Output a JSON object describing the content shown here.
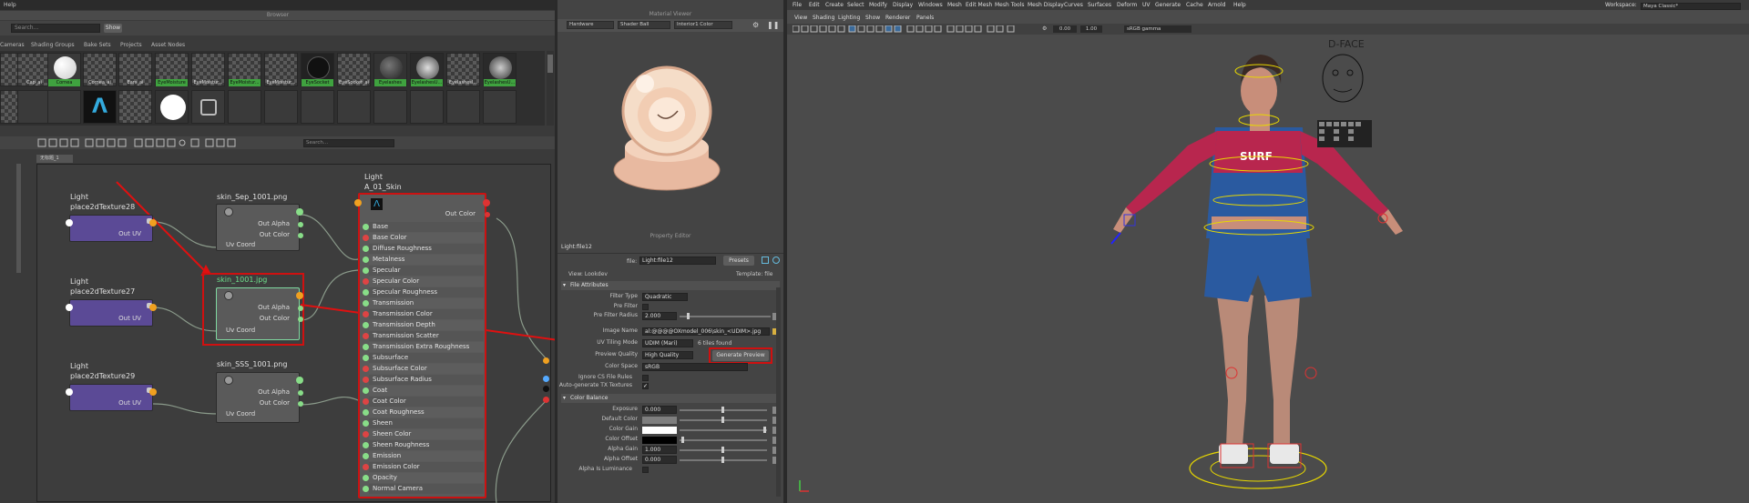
{
  "topbar": {
    "help_label": "Help"
  },
  "browser": {
    "title": "Browser",
    "search_placeholder": "Search...",
    "show_label": "Show",
    "tabs": [
      "Cameras",
      "Shading Groups",
      "Bake Sets",
      "Projects",
      "Asset Nodes"
    ],
    "thumbs_row1": [
      "",
      "Cap_ai",
      "Cornea",
      "Cornea_ai",
      "Ears_ai",
      "EyeMoisture",
      "EyeMoistur...",
      "EyeMoistur...",
      "EyeMoistur...",
      "EyeSocket",
      "EyeSocket_ai",
      "Eyelashes",
      "EyelashesU...",
      "EyelashesI...",
      "EyelashesU..."
    ],
    "green_labels": [
      "Cornea",
      "EyeMoisture",
      "EyeMoistur...",
      "EyeSocket",
      "Eyelashes",
      "EyelashesU...",
      "EyelashesU..."
    ]
  },
  "hypershade": {
    "tab_label": "无标题_1",
    "search_placeholder": "Search..."
  },
  "nodes": {
    "tex28": {
      "title1": "Light",
      "title2": "place2dTexture28",
      "out": "Out UV"
    },
    "tex27": {
      "title1": "Light",
      "title2": "place2dTexture27",
      "out": "Out UV"
    },
    "tex29": {
      "title1": "Light",
      "title2": "place2dTexture29",
      "out": "Out UV"
    },
    "sep": {
      "title": "skin_Sep_1001.png",
      "alpha": "Out Alpha",
      "color": "Out Color",
      "uv": "Uv Coord"
    },
    "skin": {
      "title": "skin_1001.jpg",
      "alpha": "Out Alpha",
      "color": "Out Color",
      "uv": "Uv Coord"
    },
    "sss": {
      "title": "skin_SSS_1001.png",
      "alpha": "Out Alpha",
      "color": "Out Color",
      "uv": "Uv Coord"
    },
    "shader": {
      "title1": "Light",
      "title2": "A_01_Skin",
      "out": "Out Color",
      "attrs": [
        "Base",
        "Base Color",
        "Diffuse Roughness",
        "Metalness",
        "Specular",
        "Specular Color",
        "Specular Roughness",
        "Transmission",
        "Transmission Color",
        "Transmission Depth",
        "Transmission Scatter",
        "Transmission Extra Roughness",
        "Subsurface",
        "Subsurface Color",
        "Subsurface Radius",
        "Coat",
        "Coat Color",
        "Coat Roughness",
        "Sheen",
        "Sheen Color",
        "Sheen Roughness",
        "Emission",
        "Emission Color",
        "Opacity",
        "Normal Camera"
      ]
    }
  },
  "material_viewer": {
    "title": "Material Viewer",
    "renderer": "Hardware",
    "shape": "Shader Ball",
    "env": "Interior1 Color"
  },
  "property_editor": {
    "title": "Property Editor",
    "node_name": "Light:file12",
    "file_label": "file:",
    "file_value": "Light:file12",
    "presets": "Presets",
    "view": "View: Lookdev",
    "template": "Template: file",
    "file_attrs": "File Attributes",
    "filter_type_lbl": "Filter Type",
    "filter_type": "Quadratic",
    "pre_filter_lbl": "Pre Filter",
    "pre_filter_radius_lbl": "Pre Filter Radius",
    "pre_filter_radius": "2.000",
    "image_name_lbl": "Image Name",
    "image_name": "al:@@@@OXmodel_006\\skin_<UDIM>.jpg",
    "tiling_lbl": "UV Tiling Mode",
    "tiling": "UDIM (Mari)",
    "tiles_found": "6 tiles found",
    "preview_q_lbl": "Preview Quality",
    "preview_q": "High Quality",
    "generate": "Generate Preview",
    "colorspace_lbl": "Color Space",
    "colorspace": "sRGB",
    "ignore_lbl": "Ignore CS File Rules",
    "autotx_lbl": "Auto-generate TX Textures",
    "color_balance": "Color Balance",
    "exposure_lbl": "Exposure",
    "exposure": "0.000",
    "default_color_lbl": "Default Color",
    "color_gain_lbl": "Color Gain",
    "color_offset_lbl": "Color Offset",
    "alpha_gain_lbl": "Alpha Gain",
    "alpha_gain": "1.000",
    "alpha_offset_lbl": "Alpha Offset",
    "alpha_offset": "0.000",
    "alpha_lum_lbl": "Alpha Is Luminance"
  },
  "viewport": {
    "menus": [
      "File",
      "Edit",
      "Create",
      "Select",
      "Modify",
      "Display",
      "Windows",
      "Mesh",
      "Edit Mesh",
      "Mesh Tools",
      "Mesh Display",
      "Curves",
      "Surfaces",
      "Deform",
      "UV",
      "Generate",
      "Cache",
      "Arnold",
      "Help"
    ],
    "workspace_lbl": "Workspace:",
    "workspace": "Maya Classic*",
    "view_menus": [
      "View",
      "Shading",
      "Lighting",
      "Show",
      "Renderer",
      "Panels"
    ],
    "val1": "0.00",
    "val2": "1.00",
    "gamma": "sRGB gamma",
    "dface": "D-FACE",
    "surf": "SURF"
  }
}
